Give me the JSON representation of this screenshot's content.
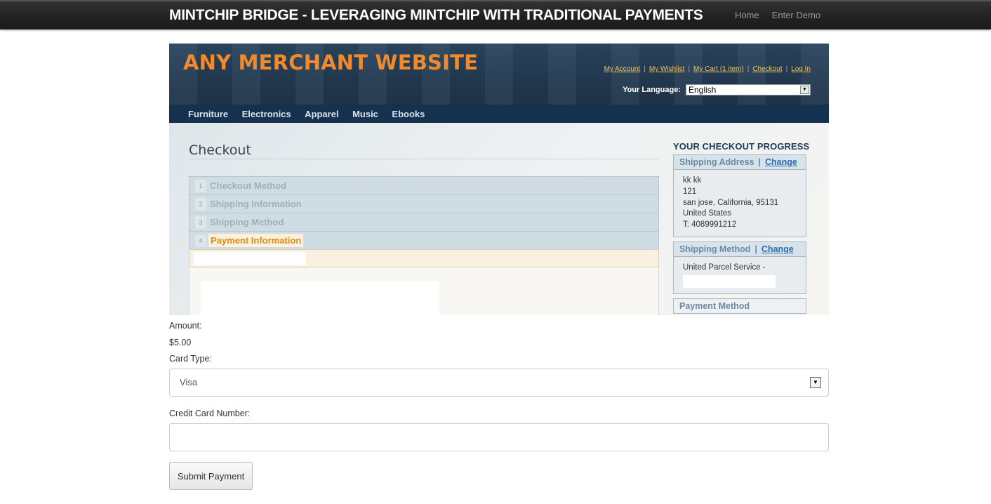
{
  "navbar": {
    "brand": "MINTCHIP BRIDGE - LEVERAGING MINTCHIP WITH TRADITIONAL PAYMENTS",
    "links": [
      "Home",
      "Enter Demo"
    ]
  },
  "merchant": {
    "logo": "ANY MERCHANT WEBSITE",
    "top_links": [
      "My Account",
      "My Wishlist",
      "My Cart (1 item)",
      "Checkout",
      "Log In"
    ],
    "language_label": "Your Language:",
    "language_value": "English",
    "nav": [
      "Furniture",
      "Electronics",
      "Apparel",
      "Music",
      "Ebooks"
    ],
    "page_title": "Checkout",
    "steps": [
      {
        "num": "1",
        "label": "Checkout Method"
      },
      {
        "num": "2",
        "label": "Shipping Information"
      },
      {
        "num": "3",
        "label": "Shipping Method"
      },
      {
        "num": "4",
        "label": "Payment Information"
      }
    ],
    "progress": {
      "title": "YOUR CHECKOUT PROGRESS",
      "shipping_address": {
        "heading": "Shipping Address",
        "change": "Change",
        "lines": [
          "kk kk",
          "121",
          "san jose, California, 95131",
          "United States",
          "T: 4089991212"
        ]
      },
      "shipping_method": {
        "heading": "Shipping Method",
        "change": "Change",
        "value": "United Parcel Service -"
      },
      "payment_method": {
        "heading": "Payment Method"
      }
    }
  },
  "form": {
    "amount_label": "Amount:",
    "amount_value": "$5.00",
    "card_type_label": "Card Type:",
    "card_type_value": "Visa",
    "card_number_label": "Credit Card Number:",
    "card_number_value": "",
    "submit_label": "Submit Payment"
  }
}
